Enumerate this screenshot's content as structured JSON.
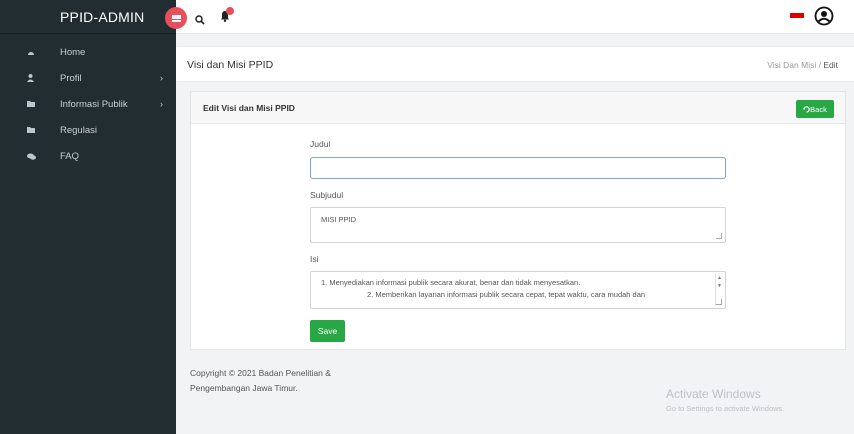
{
  "sidebar": {
    "brand": "PPID-ADMIN",
    "items": [
      {
        "label": "Home",
        "icon": "dashboard-icon"
      },
      {
        "label": "Profil",
        "icon": "user-icon",
        "chevron": "›"
      },
      {
        "label": "Informasi Publik",
        "icon": "folder-icon",
        "chevron": "›"
      },
      {
        "label": "Regulasi",
        "icon": "folder-icon"
      },
      {
        "label": "FAQ",
        "icon": "comments-icon"
      }
    ]
  },
  "header": {
    "page_title": "Visi dan Misi PPID",
    "breadcrumb_parent": "Visi Dan Misi",
    "breadcrumb_sep": "/",
    "breadcrumb_active": "Edit"
  },
  "card": {
    "title": "Edit Visi dan Misi PPID",
    "back_label": "Back"
  },
  "form": {
    "judul_label": "Judul",
    "judul_value": "",
    "subjudul_label": "Subjudul",
    "subjudul_value": "MISI PPID",
    "isi_label": "Isi",
    "isi_line1": "1. Menyediakan informasi publik secara akurat, benar dan tidak menyesatkan.",
    "isi_line2": "2. Memberikan layanan informasi publik secara cepat, tepat waktu, cara mudah dan",
    "save_label": "Save"
  },
  "footer": {
    "line1": "Copyright © 2021 Badan Penelitian &",
    "line2": "Pengembangan Jawa Timur."
  },
  "watermark": {
    "title": "Activate Windows",
    "subtitle": "Go to Settings to activate Windows."
  },
  "colors": {
    "sidebar_bg": "#222d32",
    "accent_red": "#e7505a",
    "button_green": "#28a745"
  }
}
